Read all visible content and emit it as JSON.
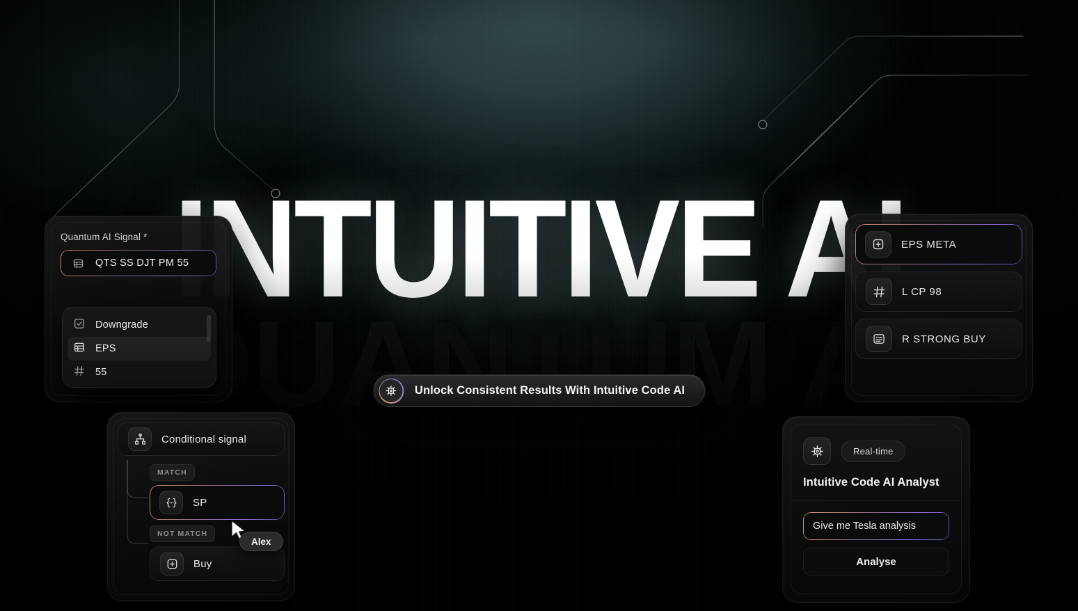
{
  "hero": {
    "headline": "INTUITIVE AI",
    "ghost_text": "QUANTUM AI",
    "cta_label": "Unlock Consistent Results With Intuitive Code AI",
    "cta_icon": "chip-gear-icon"
  },
  "signal_card": {
    "field_label": "Quantum AI Signal *",
    "selected_value": "QTS SS DJT PM 55",
    "selected_icon": "table-icon",
    "dropdown": [
      {
        "label": "Downgrade",
        "icon": "checkbox-check-icon",
        "selected": false
      },
      {
        "label": "EPS",
        "icon": "table-icon",
        "selected": true
      },
      {
        "label": "55",
        "icon": "hash-icon",
        "selected": false
      }
    ]
  },
  "signals_right": {
    "items": [
      {
        "label": "EPS META",
        "icon": "plus-square-icon",
        "highlighted": true
      },
      {
        "label": "L CP 98",
        "icon": "hash-icon",
        "highlighted": false
      },
      {
        "label": "R STRONG BUY",
        "icon": "card-list-icon",
        "highlighted": false
      }
    ]
  },
  "conditional_card": {
    "title": "Conditional signal",
    "title_icon": "branch-icon",
    "match_label": "MATCH",
    "not_match_label": "NOT MATCH",
    "match_item": {
      "label": "SP",
      "icon": "braces-icon"
    },
    "not_match_item": {
      "label": "Buy",
      "icon": "plus-square-icon"
    },
    "cursor_user": "Alex"
  },
  "analyst_card": {
    "gear_icon": "chip-gear-icon",
    "badge": "Real-time",
    "title": "Intuitive Code AI Analyst",
    "prompt_value": "Give me Tesla analysis",
    "prompt_placeholder": "Give me Tesla analysis",
    "button_label": "Analyse"
  },
  "theme": {
    "accent_orange": "#d4935f",
    "accent_purple": "#8b6fd1",
    "bg": "#010303",
    "glow_teal": "#32494c"
  }
}
